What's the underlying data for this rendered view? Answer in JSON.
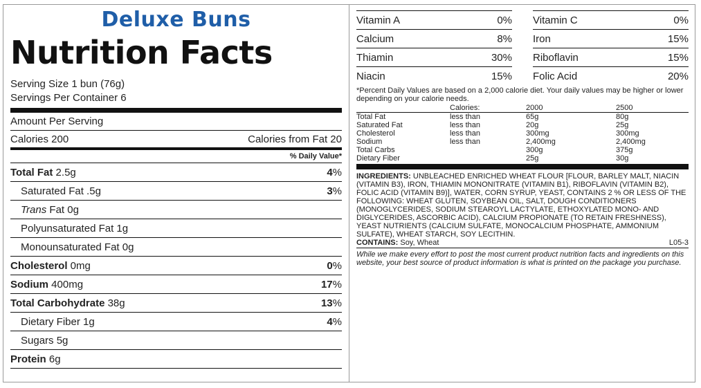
{
  "product": "Deluxe Buns",
  "title": "Nutrition Facts",
  "serving_size": "Serving Size 1 bun (76g)",
  "servings_per_container": "Servings Per Container 6",
  "amount_per_serving": "Amount Per Serving",
  "calories": "Calories 200",
  "calories_from_fat": "Calories from Fat 20",
  "daily_value_header": "% Daily Value*",
  "nutrients": [
    {
      "name": "Total Fat",
      "amount": " 2.5g",
      "dv": "4",
      "bold": true,
      "indent": false
    },
    {
      "name": "Saturated Fat",
      "amount": " .5g",
      "dv": "3",
      "bold": false,
      "indent": true
    },
    {
      "name": "Trans",
      "name2": " Fat",
      "amount": " 0g",
      "dv": "",
      "bold": false,
      "indent": true,
      "italic": true
    },
    {
      "name": "Polyunsaturated Fat",
      "amount": " 1g",
      "dv": "",
      "bold": false,
      "indent": true
    },
    {
      "name": "Monounsaturated Fat",
      "amount": " 0g",
      "dv": "",
      "bold": false,
      "indent": true
    },
    {
      "name": "Cholesterol",
      "amount": " 0mg",
      "dv": "0",
      "bold": true,
      "indent": false
    },
    {
      "name": "Sodium",
      "amount": " 400mg",
      "dv": "17",
      "bold": true,
      "indent": false
    },
    {
      "name": "Total Carbohydrate",
      "amount": " 38g",
      "dv": "13",
      "bold": true,
      "indent": false
    },
    {
      "name": "Dietary Fiber",
      "amount": " 1g",
      "dv": "4",
      "bold": false,
      "indent": true
    },
    {
      "name": "Sugars",
      "amount": " 5g",
      "dv": "",
      "bold": false,
      "indent": true
    },
    {
      "name": "Protein",
      "amount": " 6g",
      "dv": "",
      "bold": true,
      "indent": false
    }
  ],
  "vitamins": [
    [
      {
        "name": "Vitamin A",
        "dv": "0%"
      },
      {
        "name": "Vitamin C",
        "dv": "0%"
      }
    ],
    [
      {
        "name": "Calcium",
        "dv": "8%"
      },
      {
        "name": "Iron",
        "dv": "15%"
      }
    ],
    [
      {
        "name": "Thiamin",
        "dv": "30%"
      },
      {
        "name": "Riboflavin",
        "dv": "15%"
      }
    ],
    [
      {
        "name": "Niacin",
        "dv": "15%"
      },
      {
        "name": "Folic Acid",
        "dv": "20%"
      }
    ]
  ],
  "footnote": "*Percent Daily Values are based on a 2,000 calorie diet. Your daily values may be higher or lower depending on your calorie needs.",
  "calorie_table": {
    "header": [
      "",
      "Calories:",
      "2000",
      "2500"
    ],
    "rows": [
      [
        "Total Fat",
        "less than",
        "65g",
        "80g"
      ],
      [
        "Saturated Fat",
        "less than",
        "20g",
        "25g"
      ],
      [
        "Cholesterol",
        "less than",
        "300mg",
        "300mg"
      ],
      [
        "Sodium",
        "less than",
        "2,400mg",
        "2,400mg"
      ],
      [
        "Total Carbs",
        "",
        "300g",
        "375g"
      ],
      [
        "Dietary Fiber",
        "",
        "25g",
        "30g"
      ]
    ]
  },
  "ingredients_label": "INGREDIENTS:",
  "ingredients": " INGREDIENTS: UNBLEACHED ENRICHED WHEAT FLOUR [FLOUR, BARLEY MALT, NIACIN (VITAMIN B3), IRON, THIAMIN MONONITRATE (VITAMIN B1), RIBOFLAVIN (VITAMIN B2), FOLIC ACID (VITAMIN B9)], WATER, CORN SYRUP, YEAST, CONTAINS 2 % OR LESS OF THE FOLLOWING: WHEAT GLUTEN, SOYBEAN OIL, SALT, DOUGH CONDITIONERS (MONOGLYCERIDES, SODIUM STEAROYL LACTYLATE, ETHOXYLATED MONO- AND DIGLYCERIDES, ASCORBIC ACID), CALCIUM PROPIONATE (TO RETAIN FRESHNESS), YEAST NUTRIENTS (CALCIUM SULFATE, MONOCALCIUM PHOSPHATE, AMMONIUM SULFATE), WHEAT STARCH, SOY LECITHIN.",
  "contains_label": "CONTAINS:",
  "contains": " Soy, Wheat",
  "code": "L05-3",
  "disclaimer": "While we make every effort to post the most current product nutrition facts and ingredients on this website, your best source of product information is what is printed on the package you purchase.",
  "colors": {
    "product": "#1f5ea8",
    "rule": "#111111",
    "border": "#999999"
  }
}
